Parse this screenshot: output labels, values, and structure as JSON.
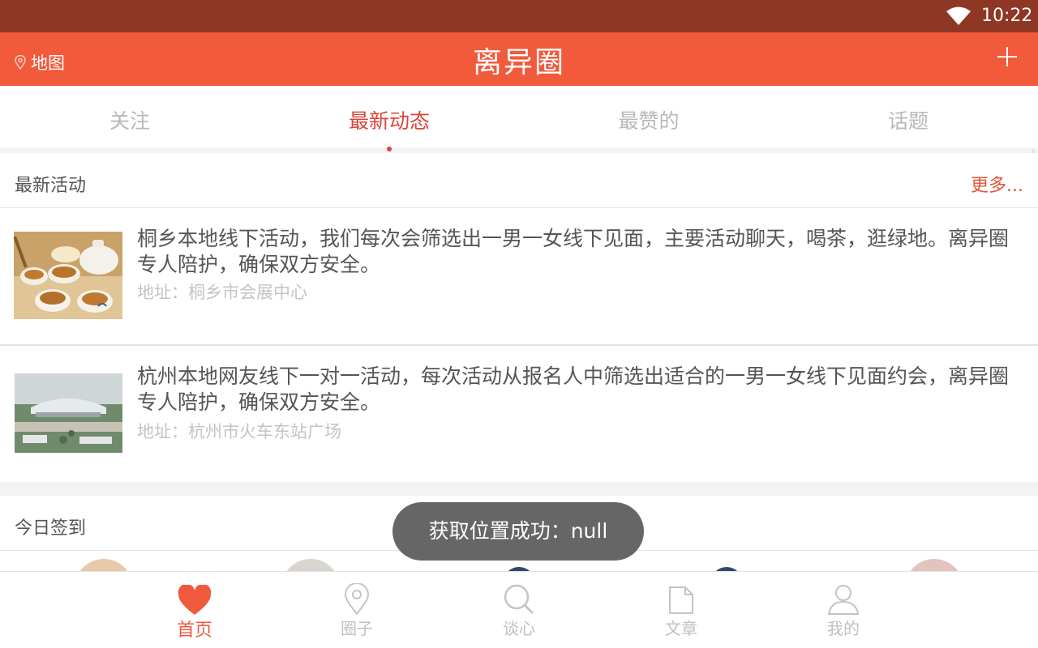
{
  "status_bar": {
    "time": "10:22",
    "wifi_icon": "wifi-icon"
  },
  "header": {
    "map_label": "地图",
    "title": "离异圈",
    "add_icon": "plus-icon",
    "color": "#f25a3c"
  },
  "tabs": [
    {
      "label": "关注",
      "active": false
    },
    {
      "label": "最新动态",
      "active": true
    },
    {
      "label": "最赞的",
      "active": false
    },
    {
      "label": "话题",
      "active": false
    }
  ],
  "latest_activity": {
    "heading": "最新活动",
    "more": "更多...",
    "items": [
      {
        "description": "桐乡本地线下活动，我们每次会筛选出一男一女线下见面，主要活动聊天，喝茶，逛绿地。离异圈专人陪护，确保双方安全。",
        "address": "地址：桐乡市会展中心",
        "image": "tea-set-photo"
      },
      {
        "description": "杭州本地网友线下一对一活动，每次活动从报名人中筛选出适合的一男一女线下见面约会，离异圈专人陪护，确保双方安全。",
        "address": "地址：杭州市火车东站广场",
        "image": "railway-station-photo"
      }
    ]
  },
  "checkin": {
    "heading": "今日签到"
  },
  "toast": {
    "text": "获取位置成功：null"
  },
  "bottom_nav": [
    {
      "label": "首页",
      "icon": "heart-icon",
      "active": true
    },
    {
      "label": "圈子",
      "icon": "location-pin-icon",
      "active": false
    },
    {
      "label": "谈心",
      "icon": "search-icon",
      "active": false
    },
    {
      "label": "文章",
      "icon": "document-icon",
      "active": false
    },
    {
      "label": "我的",
      "icon": "person-icon",
      "active": false
    }
  ]
}
